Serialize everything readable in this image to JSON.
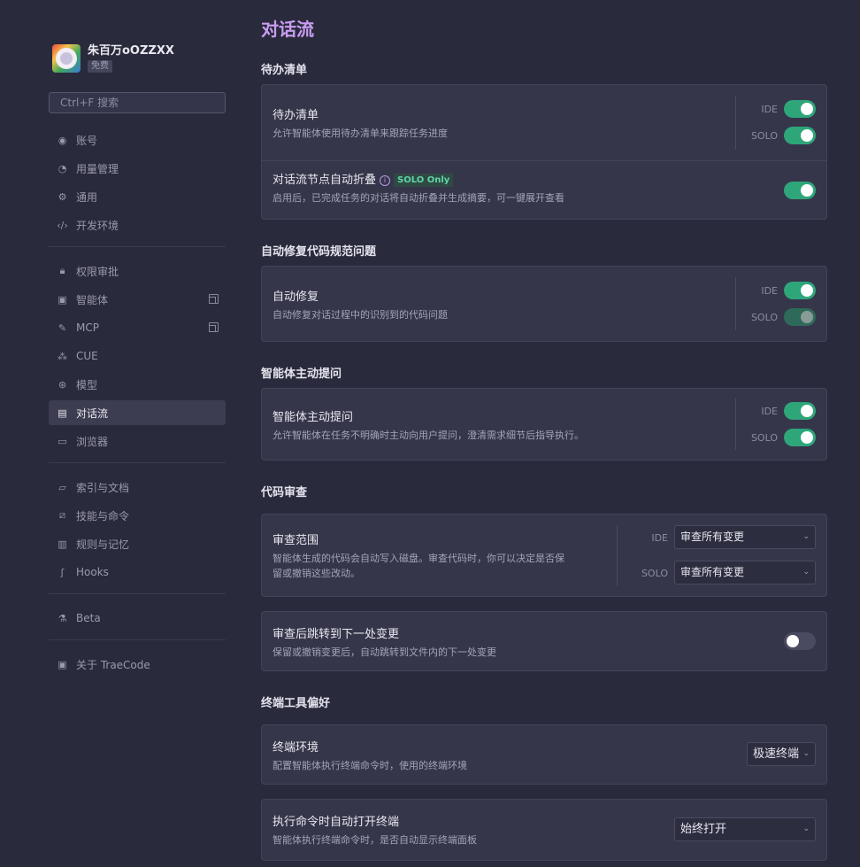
{
  "profile": {
    "name": "朱百万oOZZXX",
    "plan": "免费"
  },
  "search": {
    "placeholder": "Ctrl+F 搜索"
  },
  "nav": {
    "group1": [
      {
        "label": "账号",
        "icon": "user-icon"
      },
      {
        "label": "用量管理",
        "icon": "gauge-icon"
      },
      {
        "label": "通用",
        "icon": "gear-icon"
      },
      {
        "label": "开发环境",
        "icon": "code-icon"
      }
    ],
    "group2": [
      {
        "label": "权限审批",
        "icon": "lock-icon"
      },
      {
        "label": "智能体",
        "icon": "agent-icon"
      },
      {
        "label": "MCP",
        "icon": "wrench-icon"
      },
      {
        "label": "CUE",
        "icon": "cue-icon"
      },
      {
        "label": "模型",
        "icon": "model-icon"
      },
      {
        "label": "对话流",
        "icon": "chat-icon"
      },
      {
        "label": "浏览器",
        "icon": "browser-icon"
      }
    ],
    "group3": [
      {
        "label": "索引与文档",
        "icon": "folder-icon"
      },
      {
        "label": "技能与命令",
        "icon": "slash-icon"
      },
      {
        "label": "规则与记忆",
        "icon": "book-icon"
      },
      {
        "label": "Hooks",
        "icon": "hook-icon"
      }
    ],
    "group4": [
      {
        "label": "Beta",
        "icon": "flask-icon"
      }
    ],
    "group5": [
      {
        "label": "关于 TraeCode",
        "icon": "info-box-icon"
      }
    ]
  },
  "main": {
    "title": "对话流",
    "todo": {
      "section": "待办清单",
      "row1": {
        "title": "待办清单",
        "desc": "允许智能体使用待办清单来跟踪任务进度",
        "ide": "IDE",
        "solo": "SOLO"
      },
      "row2": {
        "title": "对话流节点自动折叠",
        "badge": "SOLO Only",
        "desc": "启用后，已完成任务的对话将自动折叠并生成摘要，可一键展开查看"
      }
    },
    "autofix": {
      "section": "自动修复代码规范问题",
      "row1": {
        "title": "自动修复",
        "desc": "自动修复对话过程中的识别到的代码问题",
        "ide": "IDE",
        "solo": "SOLO"
      }
    },
    "ask": {
      "section": "智能体主动提问",
      "row1": {
        "title": "智能体主动提问",
        "desc": "允许智能体在任务不明确时主动向用户提问，澄清需求细节后指导执行。",
        "ide": "IDE",
        "solo": "SOLO"
      }
    },
    "review": {
      "section": "代码审查",
      "row1": {
        "title": "审查范围",
        "desc1": "智能体生成的代码会自动写入磁盘。审查代码时，你可以决定是否保",
        "desc2": "留或撤销这些改动。",
        "ide": "IDE",
        "solo": "SOLO",
        "ide_value": "审查所有变更",
        "solo_value": "审查所有变更"
      },
      "row2": {
        "title": "审查后跳转到下一处变更",
        "desc": "保留或撤销变更后，自动跳转到文件内的下一处变更"
      }
    },
    "terminal": {
      "section": "终端工具偏好",
      "row1": {
        "title": "终端环境",
        "desc": "配置智能体执行终端命令时，使用的终端环境",
        "value": "极速终端"
      },
      "row2": {
        "title": "执行命令时自动打开终端",
        "desc": "智能体执行终端命令时，是否自动显示终端面板",
        "value": "始终打开"
      }
    }
  }
}
